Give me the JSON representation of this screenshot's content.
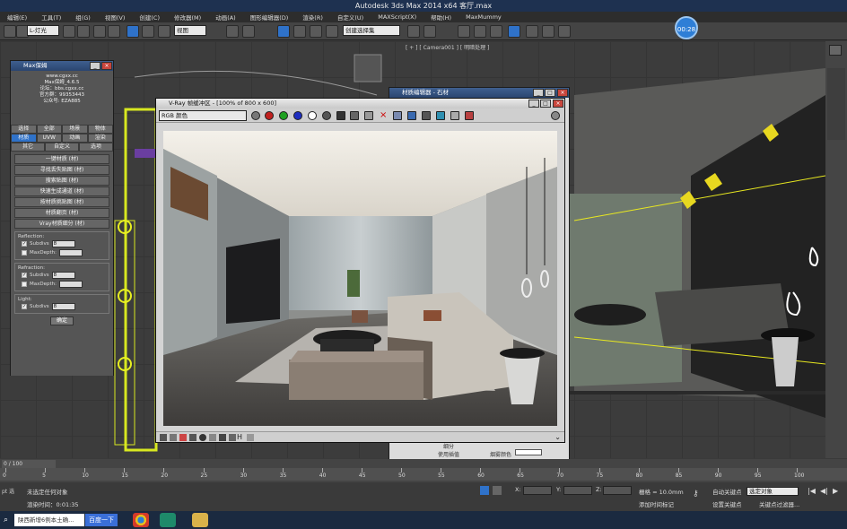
{
  "app_title": "Autodesk 3ds Max  2014 x64    客厅.max",
  "menu": [
    "编辑(E)",
    "工具(T)",
    "组(G)",
    "视图(V)",
    "创建(C)",
    "修改器(M)",
    "动画(A)",
    "图形编辑器(D)",
    "渲染(R)",
    "自定义(U)",
    "MAXScript(X)",
    "帮助(H)",
    "MaxMummy"
  ],
  "toolbar": {
    "layer_dropdown": "L-灯光",
    "view_dropdown": "视图",
    "selection_set": "创建选择集"
  },
  "timer": "00:28",
  "viewport_right_label": "[ + ] [ Camera001 ] [ 明暗处理 ]",
  "maxbox": {
    "title": "Max保姆",
    "site": "www.cgxx.cc",
    "version": "Max保姆_4.6.5",
    "forum": "论坛：bbs.cgxx.cc",
    "qq": "官方群：99353443",
    "wechat": "公众号: EZA885",
    "tabs_row1": [
      "选择",
      "全部",
      "场景",
      "物体"
    ],
    "tabs_row2": [
      "材质",
      "UVW",
      "动画",
      "渲染"
    ],
    "tabs_row3": [
      "其它",
      "自定义",
      "选项"
    ],
    "list": [
      "一键材质 (材)",
      "寻找丢失贴图 (材)",
      "搜索贴图 (材)",
      "快速生成通道 (材)",
      "按材质挑贴图 (材)",
      "材质翻页 (材)",
      "Vray材质细分 (材)"
    ],
    "reflection_label": "Reflection:",
    "refraction_label": "Refraction:",
    "light_label": "Light:",
    "subdivs_label": "Subdivs",
    "maxdepth_label": "MaxDepth:",
    "subdivs_value": "8",
    "confirm": "确定"
  },
  "vfb": {
    "title": "V-Ray 帧缓冲区 - [100% of 800 x 600]",
    "channel": "RGB 颜色"
  },
  "slate": {
    "title": "材质编辑器 - 石材",
    "label_a": "细分",
    "label_b": "使用插值",
    "label_c": "烟雾颜色"
  },
  "timeline": {
    "frame_counter": "0 / 100",
    "ticks": [
      "0",
      "5",
      "10",
      "15",
      "20",
      "25",
      "30",
      "35",
      "40",
      "45",
      "50",
      "55",
      "60",
      "65",
      "70",
      "75",
      "80",
      "85",
      "90",
      "95",
      "100"
    ]
  },
  "status": {
    "selection": "未选定任何对象",
    "render_time": "渲染时间：0:01:35",
    "grid": "栅格 = 10.0mm",
    "add_time_tag": "添加时间标记",
    "auto_key": "自动关键点",
    "selected_obj": "选定对象",
    "set_key": "设置关键点",
    "key_filter": "关键点过滤器...",
    "x_label": "X:",
    "y_label": "Y:",
    "z_label": "Z:",
    "prompt_left": "pt 选"
  },
  "taskbar": {
    "search": "陕西新增6例本土确...",
    "baidu": "百度一下"
  },
  "colors": {
    "accent": "#2f72c9",
    "title_bar": "#1e3150",
    "red_text": "#ff3a3a"
  }
}
